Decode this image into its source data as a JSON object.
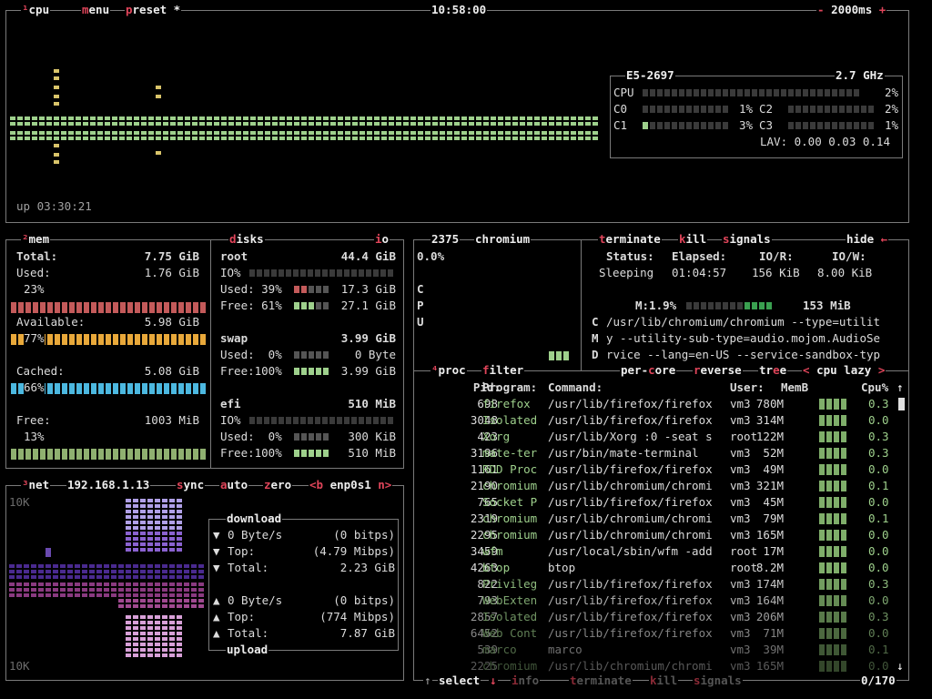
{
  "cpu": {
    "title_num": "¹",
    "title": "cpu",
    "menu": "menu",
    "preset": "preset *",
    "clock": "10:58:00",
    "interval": "2000ms",
    "minus": "-",
    "plus": "+",
    "uptime": "up 03:30:21",
    "model": "E5-2697",
    "freq": "2.7 GHz",
    "total_label": "CPU",
    "total_pct": "2%",
    "cores": [
      {
        "label": "C0",
        "pct": "1%"
      },
      {
        "label": "C1",
        "pct": "3%"
      },
      {
        "label": "C2",
        "pct": "2%"
      },
      {
        "label": "C3",
        "pct": "1%"
      }
    ],
    "lav": "LAV: 0.00 0.03 0.14"
  },
  "mem": {
    "title_num": "²",
    "title": "mem",
    "total_label": "Total:",
    "total_val": "7.75 GiB",
    "used_label": "Used:",
    "used_val": "1.76 GiB",
    "used_pct": "23%",
    "avail_label": "Available:",
    "avail_val": "5.98 GiB",
    "avail_pct": "77%",
    "cached_label": "Cached:",
    "cached_val": "5.08 GiB",
    "cached_pct": "66%",
    "free_label": "Free:",
    "free_val": "1003 MiB",
    "free_pct": "13%"
  },
  "disks": {
    "title": "disks",
    "io": "io",
    "items": [
      {
        "name": "root",
        "size": "44.4 GiB",
        "io": "IO%",
        "used_label": "Used: 39%",
        "used_val": "17.3 GiB",
        "free_label": "Free: 61%",
        "free_val": "27.1 GiB"
      },
      {
        "name": "swap",
        "size": "3.99 GiB",
        "used_label": "Used:  0%",
        "used_val": "0 Byte",
        "free_label": "Free:100%",
        "free_val": "3.99 GiB"
      },
      {
        "name": "efi",
        "size": "510 MiB",
        "io": "IO%",
        "used_label": "Used:  0%",
        "used_val": "300 KiB",
        "free_label": "Free:100%",
        "free_val": "510 MiB"
      }
    ]
  },
  "net": {
    "title_num": "³",
    "title": "net",
    "ip": "192.168.1.13",
    "sync": "sync",
    "auto": "auto",
    "zero": "zero",
    "prev": "<b",
    "iface": "enp0s1",
    "next": "n>",
    "scale_top": "10K",
    "scale_bottom": "10K",
    "download_title": "download",
    "upload_title": "upload",
    "dl": [
      {
        "arrow": "▼",
        "label": "0 Byte/s",
        "val": "(0 bitps)"
      },
      {
        "arrow": "▼",
        "label": "Top:",
        "val": "(4.79 Mibps)"
      },
      {
        "arrow": "▼",
        "label": "Total:",
        "val": "2.23 GiB"
      }
    ],
    "ul": [
      {
        "arrow": "▲",
        "label": "0 Byte/s",
        "val": "(0 bitps)"
      },
      {
        "arrow": "▲",
        "label": "Top:",
        "val": "(774 Mibps)"
      },
      {
        "arrow": "▲",
        "label": "Total:",
        "val": "7.87 GiB"
      }
    ]
  },
  "detail": {
    "pid": "2375",
    "name": "chromium",
    "terminate": "terminate",
    "kill": "kill",
    "signals": "signals",
    "hide": "hide",
    "cpu_pct": "0.0%",
    "cpu_letters": [
      "C",
      "P",
      "U"
    ],
    "status_label": "Status:",
    "status_val": "Sleeping",
    "elapsed_label": "Elapsed:",
    "elapsed_val": "01:04:57",
    "ior_label": "IO/R:",
    "ior_val": "156 KiB",
    "iow_label": "IO/W:",
    "iow_val": "8.00 KiB",
    "mem_label": "M:1.9%",
    "mem_val": "153 MiB",
    "cmd_letters": [
      "C",
      "M",
      "D"
    ],
    "cmd_lines": [
      "/usr/lib/chromium/chromium --type=utilit",
      "y --utility-sub-type=audio.mojom.AudioSe",
      "rvice --lang=en-US --service-sandbox-typ"
    ]
  },
  "proc": {
    "title_num": "⁴",
    "title": "proc",
    "filter": "filter",
    "per_core": "per-core",
    "reverse": "reverse",
    "tree": "tree",
    "sort_prev": "<",
    "sort": "cpu lazy",
    "sort_next": ">",
    "headers": {
      "pid": "Pid:",
      "program": "Program:",
      "command": "Command:",
      "user": "User:",
      "mem": "MemB",
      "cpu": "Cpu%"
    },
    "rows": [
      {
        "pid": "698",
        "program": "firefox",
        "command": "/usr/lib/firefox/firefox",
        "user": "vm3",
        "mem": "780M",
        "cpu": "0.3"
      },
      {
        "pid": "3048",
        "program": "Isolated",
        "command": "/usr/lib/firefox/firefox",
        "user": "vm3",
        "mem": "314M",
        "cpu": "0.0"
      },
      {
        "pid": "423",
        "program": "Xorg",
        "command": "/usr/lib/Xorg :0 -seat s",
        "user": "root",
        "mem": "122M",
        "cpu": "0.3"
      },
      {
        "pid": "3196",
        "program": "mate-ter",
        "command": "/usr/bin/mate-terminal",
        "user": "vm3",
        "mem": "52M",
        "cpu": "0.3"
      },
      {
        "pid": "1161",
        "program": "RDD Proc",
        "command": "/usr/lib/firefox/firefox",
        "user": "vm3",
        "mem": "49M",
        "cpu": "0.0"
      },
      {
        "pid": "2190",
        "program": "chromium",
        "command": "/usr/lib/chromium/chromi",
        "user": "vm3",
        "mem": "321M",
        "cpu": "0.1"
      },
      {
        "pid": "765",
        "program": "Socket P",
        "command": "/usr/lib/firefox/firefox",
        "user": "vm3",
        "mem": "45M",
        "cpu": "0.0"
      },
      {
        "pid": "2319",
        "program": "chromium",
        "command": "/usr/lib/chromium/chromi",
        "user": "vm3",
        "mem": "79M",
        "cpu": "0.1"
      },
      {
        "pid": "2295",
        "program": "chromium",
        "command": "/usr/lib/chromium/chromi",
        "user": "vm3",
        "mem": "165M",
        "cpu": "0.0"
      },
      {
        "pid": "3459",
        "program": "wfm",
        "command": "/usr/local/sbin/wfm -add",
        "user": "root",
        "mem": "17M",
        "cpu": "0.0"
      },
      {
        "pid": "4263",
        "program": "btop",
        "command": "btop",
        "user": "root",
        "mem": "8.2M",
        "cpu": "0.0"
      },
      {
        "pid": "822",
        "program": "Privileg",
        "command": "/usr/lib/firefox/firefox",
        "user": "vm3",
        "mem": "174M",
        "cpu": "0.3"
      },
      {
        "pid": "793",
        "program": "WebExten",
        "command": "/usr/lib/firefox/firefox",
        "user": "vm3",
        "mem": "164M",
        "cpu": "0.0"
      },
      {
        "pid": "2857",
        "program": "Isolated",
        "command": "/usr/lib/firefox/firefox",
        "user": "vm3",
        "mem": "206M",
        "cpu": "0.3"
      },
      {
        "pid": "6452",
        "program": "Web Cont",
        "command": "/usr/lib/firefox/firefox",
        "user": "vm3",
        "mem": "71M",
        "cpu": "0.0"
      },
      {
        "pid": "539",
        "program": "marco",
        "command": "marco",
        "user": "vm3",
        "mem": "39M",
        "cpu": "0.1"
      },
      {
        "pid": "2225",
        "program": "chromium",
        "command": "/usr/lib/chromium/chromi",
        "user": "vm3",
        "mem": "165M",
        "cpu": "0.0"
      }
    ],
    "footer": {
      "up": "↑",
      "select": "select",
      "down": "↓",
      "info": "info",
      "terminate": "terminate",
      "kill": "kill",
      "signals": "signals",
      "count": "0/170"
    }
  },
  "colors": {
    "border": "#7a7a7a",
    "hotkey": "#e0455a",
    "graph_green": "#9ed08c",
    "graph_yellow": "#d9c46a",
    "mem_red": "#c35a5a",
    "mem_orange": "#e8a83a",
    "mem_cyan": "#4cb8e0",
    "mem_green": "#8fb070",
    "net_purple": "#8a62d0",
    "net_magenta": "#c060b0"
  }
}
